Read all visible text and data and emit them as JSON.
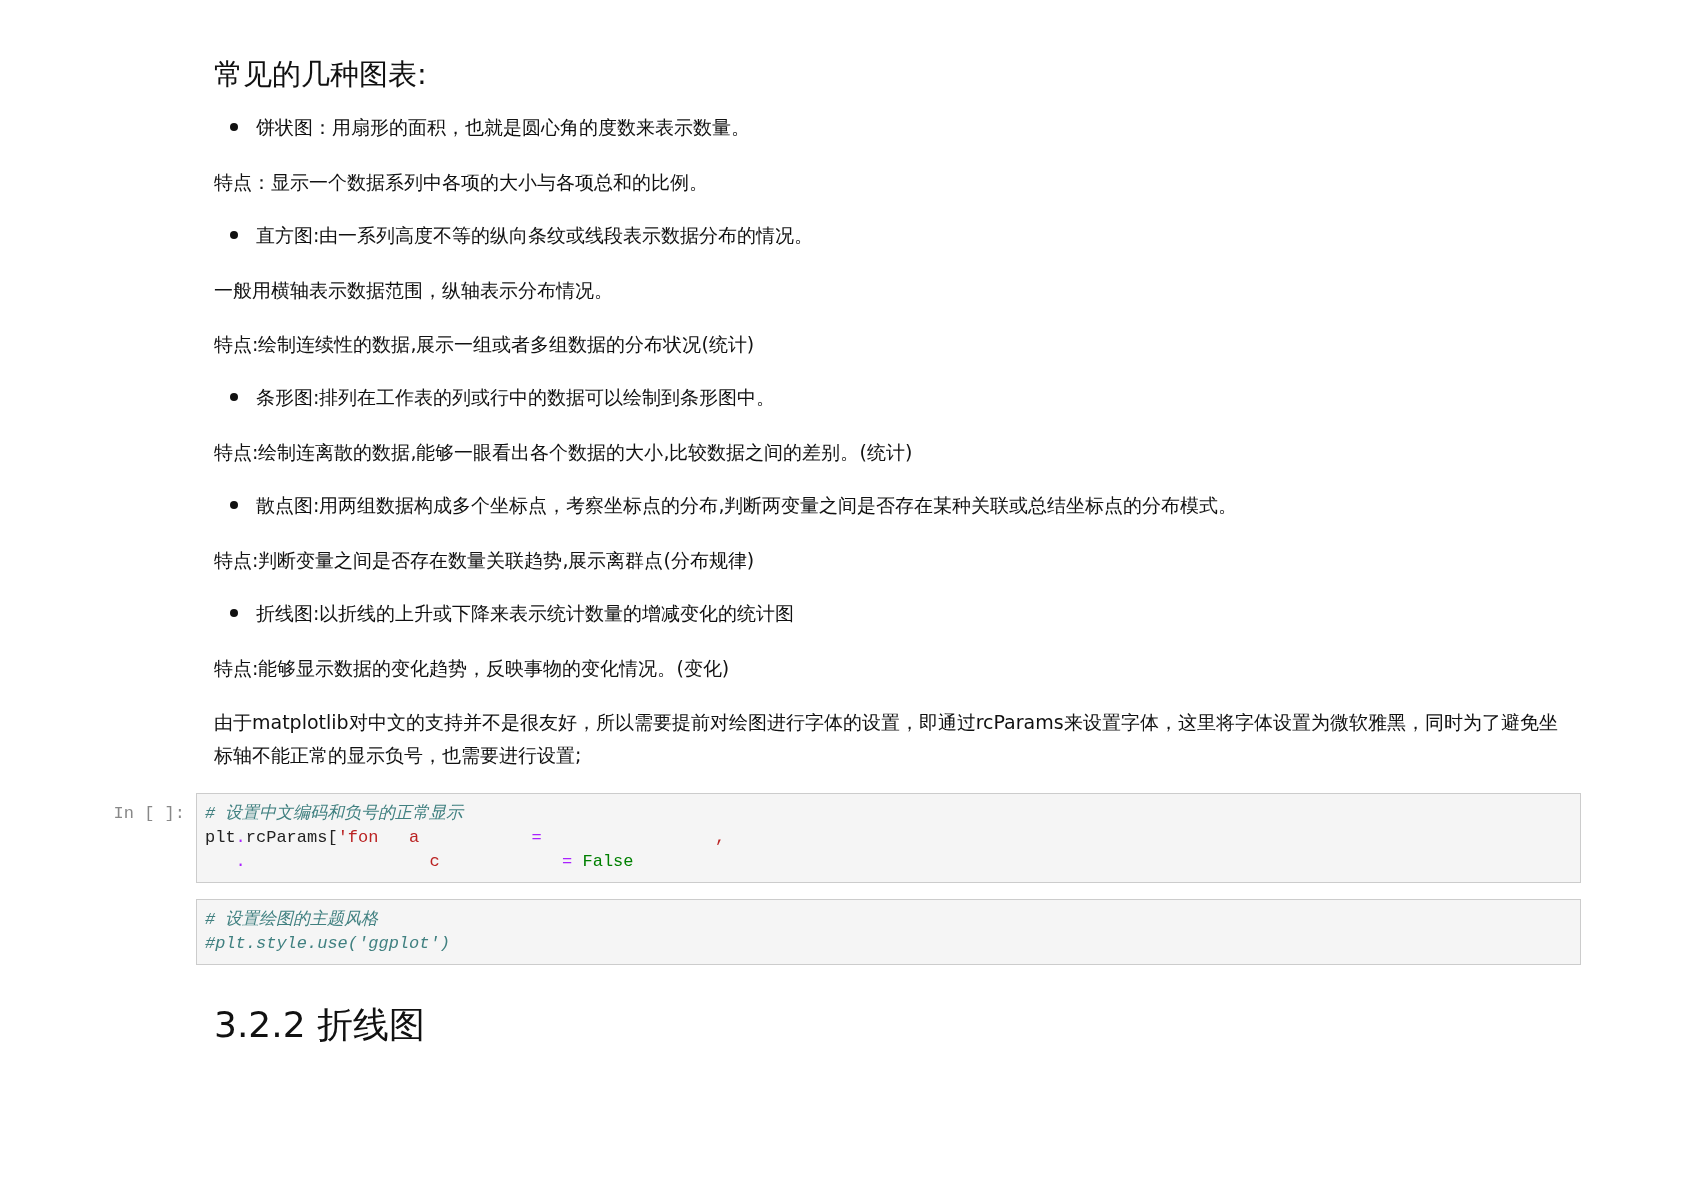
{
  "markdown": [
    {
      "kind": "heading",
      "text": "常见的几种图表:"
    },
    {
      "kind": "bullet",
      "text": "饼状图：用扇形的面积，也就是圆心角的度数来表示数量。"
    },
    {
      "kind": "para",
      "text": "特点：显示一个数据系列中各项的大小与各项总和的比例。"
    },
    {
      "kind": "bullet",
      "text": "直方图:由一系列高度不等的纵向条纹或线段表示数据分布的情况。"
    },
    {
      "kind": "para",
      "text": "一般用横轴表示数据范围，纵轴表示分布情况。"
    },
    {
      "kind": "para",
      "text": "特点:绘制连续性的数据,展示一组或者多组数据的分布状况(统计)"
    },
    {
      "kind": "bullet",
      "text": "条形图:排列在工作表的列或行中的数据可以绘制到条形图中。"
    },
    {
      "kind": "para",
      "text": "特点:绘制连离散的数据,能够一眼看出各个数据的大小,比较数据之间的差别。(统计)"
    },
    {
      "kind": "bullet",
      "text": "散点图:用两组数据构成多个坐标点，考察坐标点的分布,判断两变量之间是否存在某种关联或总结坐标点的分布模式。"
    },
    {
      "kind": "para",
      "text": "特点:判断变量之间是否存在数量关联趋势,展示离群点(分布规律)"
    },
    {
      "kind": "bullet",
      "text": "折线图:以折线的上升或下降来表示统计数量的增减变化的统计图"
    },
    {
      "kind": "para",
      "text": "特点:能够显示数据的变化趋势，反映事物的变化情况。(变化)"
    },
    {
      "kind": "para",
      "text": "由于matplotlib对中文的支持并不是很友好，所以需要提前对绘图进行字体的设置，即通过rcParams来设置字体，这里将字体设置为微软雅黑，同时为了避免坐标轴不能正常的显示负号，也需要进行设置;"
    }
  ],
  "cells": [
    {
      "prompt": "In [ ]:",
      "lines": [
        [
          {
            "kind": "comment",
            "text": "# 设置中文编码和负号的正常显示"
          }
        ],
        [
          {
            "kind": "name",
            "text": "plt"
          },
          {
            "kind": "op",
            "text": "."
          },
          {
            "kind": "name",
            "text": "rcParams["
          },
          {
            "kind": "string",
            "text": "'fon   a"
          },
          {
            "kind": "op",
            "text": "           ="
          },
          {
            "kind": "string",
            "text": "                 ,"
          }
        ],
        [
          {
            "kind": "op",
            "text": "   ."
          },
          {
            "kind": "string",
            "text": "                  c"
          },
          {
            "kind": "op",
            "text": "            ="
          },
          {
            "kind": "keyword",
            "text": " False"
          }
        ]
      ]
    },
    {
      "lines": [
        [
          {
            "kind": "comment",
            "text": "# 设置绘图的主题风格"
          }
        ],
        [
          {
            "kind": "comment",
            "text": "#plt.style.use('ggplot')"
          }
        ]
      ]
    }
  ],
  "section_heading": "3.2.2 折线图"
}
